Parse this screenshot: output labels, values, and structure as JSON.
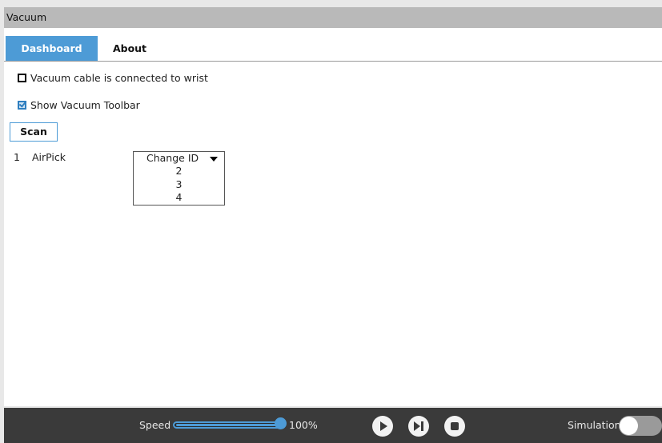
{
  "window": {
    "title": "Vacuum"
  },
  "tabs": [
    {
      "label": "Dashboard",
      "active": true
    },
    {
      "label": "About",
      "active": false
    }
  ],
  "settings": {
    "cable_connected": {
      "label": "Vacuum cable is connected to wrist",
      "checked": false
    },
    "show_toolbar": {
      "label": "Show Vacuum Toolbar",
      "checked": true
    }
  },
  "scan_button": {
    "label": "Scan"
  },
  "devices": [
    {
      "index": "1",
      "name": "AirPick",
      "action": "Change ID"
    }
  ],
  "id_dropdown": {
    "selected": "Change ID",
    "options": [
      "2",
      "3",
      "4"
    ],
    "expanded": true
  },
  "footer": {
    "speed_label": "Speed",
    "speed_value": "100%",
    "speed_fraction": 1.0,
    "controls": [
      "play-icon",
      "step-icon",
      "stop-icon"
    ],
    "simulation_label": "Simulation",
    "simulation_on": false
  },
  "colors": {
    "accent": "#4d9bd6",
    "titlebar": "#b9b9b9",
    "footer_bg": "#3a3a3a"
  }
}
